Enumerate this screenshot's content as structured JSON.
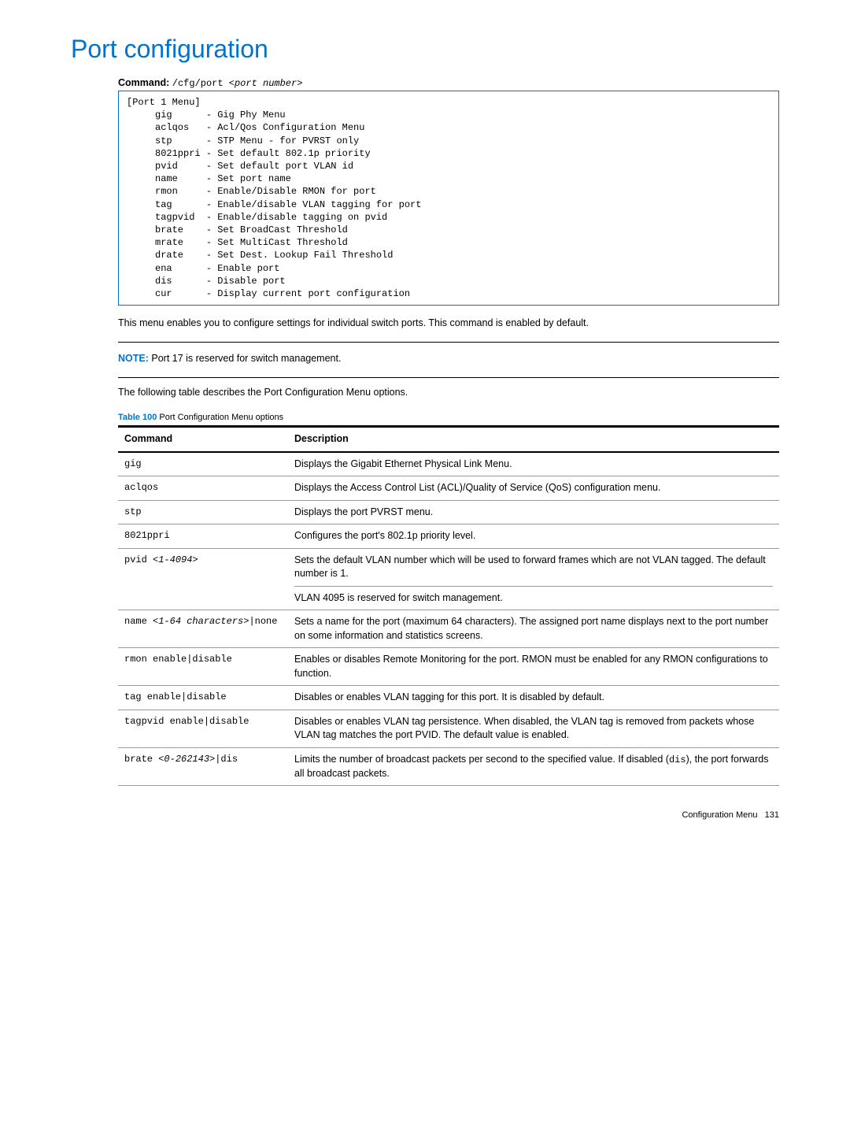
{
  "title": "Port configuration",
  "command": {
    "label": "Command:",
    "prefix": "/cfg/port ",
    "arg": "<port number>"
  },
  "codebox": "[Port 1 Menu]\n     gig      - Gig Phy Menu\n     aclqos   - Acl/Qos Configuration Menu\n     stp      - STP Menu - for PVRST only\n     8021ppri - Set default 802.1p priority\n     pvid     - Set default port VLAN id\n     name     - Set port name\n     rmon     - Enable/Disable RMON for port\n     tag      - Enable/disable VLAN tagging for port\n     tagpvid  - Enable/disable tagging on pvid\n     brate    - Set BroadCast Threshold\n     mrate    - Set MultiCast Threshold\n     drate    - Set Dest. Lookup Fail Threshold\n     ena      - Enable port\n     dis      - Disable port\n     cur      - Display current port configuration",
  "intro": "This menu enables you to configure settings for individual switch ports. This command is enabled by default.",
  "note": {
    "label": "NOTE:",
    "text": " Port 17 is reserved for switch management."
  },
  "following": "The following table describes the Port Configuration Menu options.",
  "table": {
    "caption_num": "Table 100",
    "caption_text": "  Port Configuration Menu options",
    "head_cmd": "Command",
    "head_desc": "Description",
    "rows": [
      {
        "cmd_plain": "gig",
        "cmd_italic": "",
        "desc": "Displays the Gigabit Ethernet Physical Link Menu."
      },
      {
        "cmd_plain": "aclqos",
        "cmd_italic": "",
        "desc": "Displays the Access Control List (ACL)/Quality of Service (QoS) configuration menu."
      },
      {
        "cmd_plain": "stp",
        "cmd_italic": "",
        "desc": "Displays the port PVRST menu."
      },
      {
        "cmd_plain": "8021ppri",
        "cmd_italic": "",
        "desc": "Configures the port's 802.1p priority level."
      },
      {
        "cmd_plain": "pvid ",
        "cmd_italic": "<1-4094>",
        "desc_line1": "Sets the default VLAN number which will be used to forward frames which are not VLAN tagged. The default number is 1.",
        "desc_line2": "VLAN 4095 is reserved for switch management."
      },
      {
        "cmd_plain": "name ",
        "cmd_italic": "<1-64 characters>",
        "cmd_tail": "|none",
        "desc": "Sets a name for the port (maximum 64 characters). The assigned port name displays next to the port number on some information and statistics screens."
      },
      {
        "cmd_plain": "rmon enable|disable",
        "cmd_italic": "",
        "desc": "Enables or disables Remote Monitoring for the port. RMON must be enabled for any RMON configurations to function."
      },
      {
        "cmd_plain": "tag enable|disable",
        "cmd_italic": "",
        "desc": "Disables or enables VLAN tagging for this port. It is disabled by default."
      },
      {
        "cmd_plain": "tagpvid enable|disable",
        "cmd_italic": "",
        "desc": "Disables or enables VLAN tag persistence. When disabled, the VLAN tag is removed from packets whose VLAN tag matches the port PVID. The default value is enabled."
      },
      {
        "cmd_plain": "brate ",
        "cmd_italic": "<0-262143>",
        "cmd_tail": "|dis",
        "desc_prefix": "Limits the number of broadcast packets per second to the specified value. If disabled (",
        "desc_mono": "dis",
        "desc_suffix": "), the port forwards all broadcast packets."
      }
    ]
  },
  "footer": {
    "section": "Configuration Menu",
    "page": "131"
  }
}
